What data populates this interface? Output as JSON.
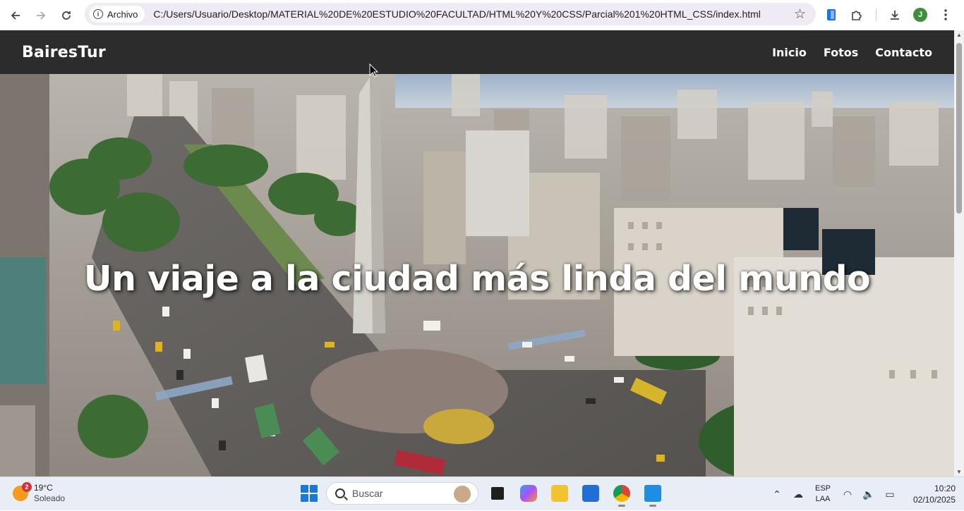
{
  "browser": {
    "site_chip": "Archivo",
    "url": "C:/Users/Usuario/Desktop/MATERIAL%20DE%20ESTUDIO%20FACULTAD/HTML%20Y%20CSS/Parcial%201%20HTML_CSS/index.html",
    "profile_initial": "J"
  },
  "site": {
    "brand": "BairesTur",
    "nav": [
      {
        "label": "Inicio"
      },
      {
        "label": "Fotos"
      },
      {
        "label": "Contacto"
      }
    ],
    "hero_title": "Un viaje a la ciudad más linda del mundo"
  },
  "taskbar": {
    "weather_temp": "19°C",
    "weather_desc": "Soleado",
    "weather_badge": "2",
    "search_placeholder": "Buscar",
    "lang_primary": "ESP",
    "lang_secondary": "LAA",
    "time": "10:20",
    "date": "02/10/2025"
  }
}
